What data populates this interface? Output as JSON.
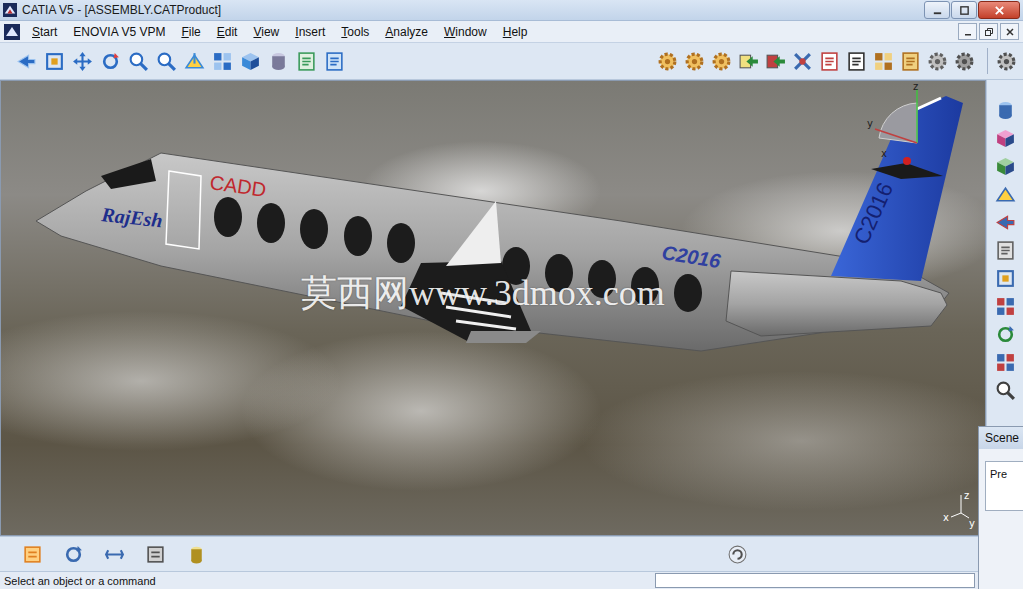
{
  "window": {
    "title": "CATIA V5 - [ASSEMBLY.CATProduct]"
  },
  "menu": [
    {
      "label": "Start",
      "accel_index": 0
    },
    {
      "label": "ENOVIA V5 VPM",
      "accel_index": -1
    },
    {
      "label": "File",
      "accel_index": 0
    },
    {
      "label": "Edit",
      "accel_index": 0
    },
    {
      "label": "View",
      "accel_index": 0
    },
    {
      "label": "Insert",
      "accel_index": 0
    },
    {
      "label": "Tools",
      "accel_index": 0
    },
    {
      "label": "Analyze",
      "accel_index": 0
    },
    {
      "label": "Window",
      "accel_index": 0
    },
    {
      "label": "Help",
      "accel_index": 0
    }
  ],
  "viewport": {
    "watermark": "莫西网www.3dmox.com",
    "model_labels": {
      "nose": "RajEsh",
      "door": "CADD",
      "body": "C2016",
      "tail": "C2016"
    },
    "compass_axes": [
      "z",
      "y",
      "x"
    ],
    "triad_axes": [
      "z",
      "x",
      "y"
    ]
  },
  "scene_panel": {
    "title": "Scene",
    "field_label": "Pre"
  },
  "status_bar": {
    "prompt": "Select an object or a command"
  }
}
